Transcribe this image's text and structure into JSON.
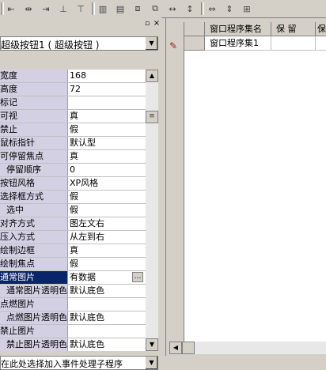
{
  "toolbar": {
    "buttons": [
      "align-left-icon",
      "align-center-icon",
      "align-right-icon",
      "align-top-icon",
      "align-middle-icon",
      "align-bottom-icon",
      "space-horizontal-icon",
      "space-vertical-icon",
      "same-width-icon",
      "same-height-icon",
      "same-size-icon"
    ]
  },
  "panel": {
    "pin_icon": "pin-icon",
    "close_icon": "close-icon",
    "object_selector": "超级按钮1 ( 超级按钮 )",
    "event_selector": "在此处选择加入事件处理子程序"
  },
  "properties": [
    {
      "name": "宽度",
      "value": "168"
    },
    {
      "name": "高度",
      "value": "72"
    },
    {
      "name": "标记",
      "value": ""
    },
    {
      "name": "可视",
      "value": "真"
    },
    {
      "name": "禁止",
      "value": "假"
    },
    {
      "name": "鼠标指针",
      "value": "默认型"
    },
    {
      "name": "可停留焦点",
      "value": "真"
    },
    {
      "name": "停留顺序",
      "value": "0",
      "sub": true
    },
    {
      "name": "按钮风格",
      "value": "XP风格"
    },
    {
      "name": "选择框方式",
      "value": "假"
    },
    {
      "name": "选中",
      "value": "假",
      "sub": true
    },
    {
      "name": "对齐方式",
      "value": "图左文右"
    },
    {
      "name": "压入方式",
      "value": "从左到右"
    },
    {
      "name": "绘制边框",
      "value": "真"
    },
    {
      "name": "绘制焦点",
      "value": "假"
    },
    {
      "name": "通常图片",
      "value": "有数据",
      "selected": true
    },
    {
      "name": "通常图片透明色",
      "value": "默认底色",
      "sub": true
    },
    {
      "name": "点燃图片",
      "value": ""
    },
    {
      "name": "点燃图片透明色",
      "value": "默认底色",
      "sub": true
    },
    {
      "name": "禁止图片",
      "value": ""
    },
    {
      "name": "禁止图片透明色",
      "value": "默认底色",
      "sub": true
    }
  ],
  "table": {
    "columns": [
      "窗口程序集名",
      "保 留",
      "保"
    ],
    "rows": [
      [
        "窗口程序集1",
        "",
        ""
      ]
    ]
  },
  "colors": {
    "selected_row": "#0a246a",
    "name_column": "#d4d0e4",
    "pencil": "#a02020"
  }
}
